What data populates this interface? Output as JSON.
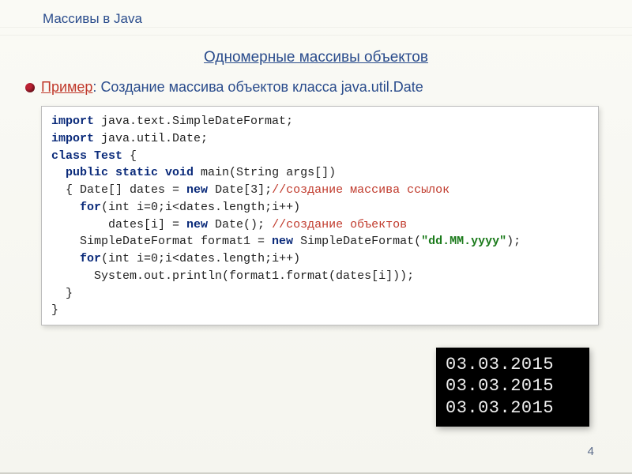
{
  "header": {
    "title": "Массивы в Java"
  },
  "section": {
    "title": "Одномерные массивы объектов"
  },
  "bullet": {
    "example_label": "Пример",
    "example_colon": ":",
    "example_text": "Создание массива объектов класса java.util.Date"
  },
  "code": {
    "line1_kw_import": "import",
    "line1_rest": " java.text.SimpleDateFormat;",
    "line2_kw_import": "import",
    "line2_rest": " java.util.Date;",
    "line3_kw_class": "class",
    "line3_name": " Test",
    "line3_brace": " {",
    "line4_indent": "  ",
    "line4_mods": "public static void",
    "line4_sig": " main(String args[])",
    "line5_indent": "  { ",
    "line5_type": "Date[] dates = ",
    "line5_kw_new": "new",
    "line5_rest": " Date[3];",
    "line5_comment": "//создание массива ссылок",
    "line6_indent": "    ",
    "line6_kw_for": "for",
    "line6_rest": "(int i=0;i<dates.length;i++)",
    "line7_indent": "        dates[i] = ",
    "line7_kw_new": "new",
    "line7_rest": " Date(); ",
    "line7_comment": "//создание объектов",
    "line8_indent": "    SimpleDateFormat format1 = ",
    "line8_kw_new": "new",
    "line8_rest1": " SimpleDateFormat(",
    "line8_str": "\"dd.MM.yyyy\"",
    "line8_rest2": ");",
    "line9_indent": "    ",
    "line9_kw_for": "for",
    "line9_rest": "(int i=0;i<dates.length;i++)",
    "line10": "      System.out.println(format1.format(dates[i]));",
    "line11": "  }",
    "line12": "}"
  },
  "output": {
    "lines": [
      "03.03.2015",
      "03.03.2015",
      "03.03.2015"
    ]
  },
  "page_number": "4"
}
